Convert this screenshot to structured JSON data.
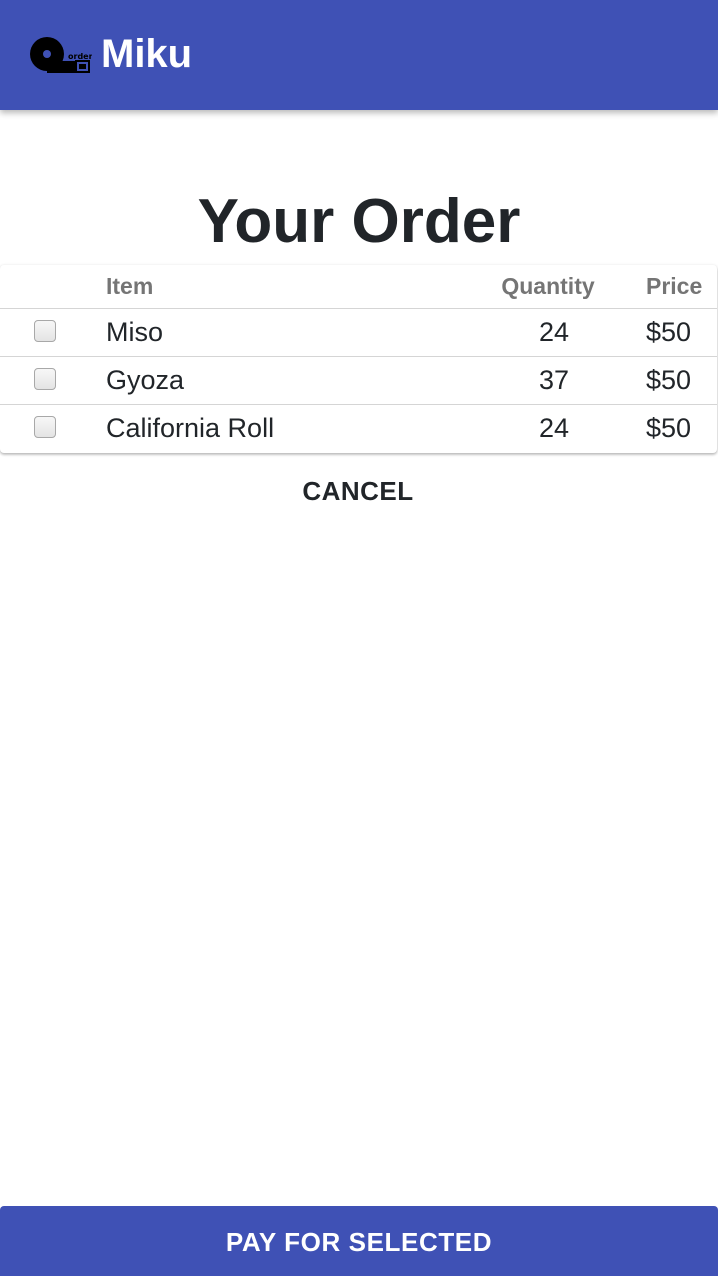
{
  "app_bar": {
    "logo_icon": "order-qr-logo",
    "logo_text": "order",
    "title": "Miku",
    "background_color": "#3f51b5"
  },
  "page": {
    "title": "Your Order"
  },
  "order_table": {
    "headers": {
      "item": "Item",
      "quantity": "Quantity",
      "price": "Price"
    },
    "rows": [
      {
        "item": "Miso",
        "quantity": "24",
        "price": "$50",
        "checked": false
      },
      {
        "item": "Gyoza",
        "quantity": "37",
        "price": "$50",
        "checked": false
      },
      {
        "item": "California Roll",
        "quantity": "24",
        "price": "$50",
        "checked": false
      }
    ]
  },
  "actions": {
    "cancel_label": "CANCEL",
    "pay_label": "PAY FOR SELECTED",
    "pay_button_color": "#3f51b5"
  }
}
